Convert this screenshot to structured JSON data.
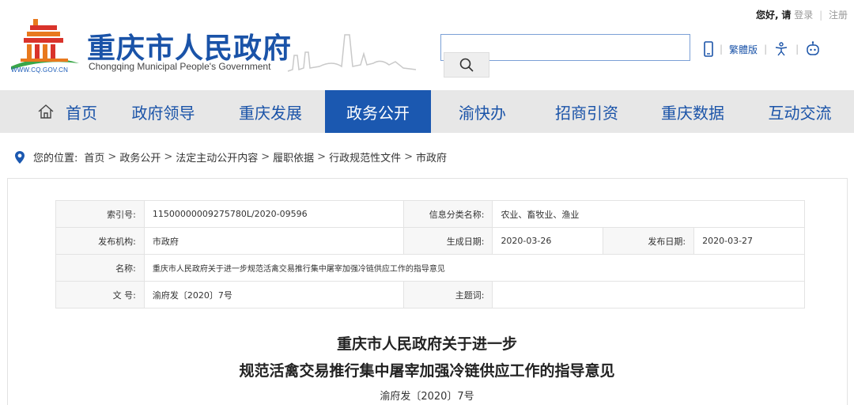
{
  "header": {
    "logo_url": "WWW.CQ.GOV.CN",
    "site_name_cn": "重庆市人民政府",
    "site_name_en": "Chongqing Municipal People's Government",
    "greeting": "您好,",
    "please": "请",
    "login": "登录",
    "register": "注册",
    "traditional": "繁體版"
  },
  "nav": {
    "items": [
      "首页",
      "政府领导",
      "重庆发展",
      "政务公开",
      "渝快办",
      "招商引资",
      "重庆数据",
      "互动交流"
    ],
    "active_index": 3
  },
  "breadcrumb": {
    "label": "您的位置:",
    "items": [
      "首页",
      "政务公开",
      "法定主动公开内容",
      "履职依据",
      "行政规范性文件",
      "市政府"
    ]
  },
  "meta": {
    "index_label": "索引号:",
    "index_value": "11500000009275780L/2020-09596",
    "category_label": "信息分类名称:",
    "category_value": "农业、畜牧业、渔业",
    "issuer_label": "发布机构:",
    "issuer_value": "市政府",
    "created_label": "生成日期:",
    "created_value": "2020-03-26",
    "published_label": "发布日期:",
    "published_value": "2020-03-27",
    "name_label": "名称:",
    "name_value": "重庆市人民政府关于进一步规范活禽交易推行集中屠宰加强冷链供应工作的指导意见",
    "docno_label": "文 号:",
    "docno_value": "渝府发〔2020〕7号",
    "subject_label": "主题词:",
    "subject_value": ""
  },
  "document": {
    "title_line1": "重庆市人民政府关于进一步",
    "title_line2": "规范活禽交易推行集中屠宰加强冷链供应工作的指导意见",
    "doc_number": "渝府发〔2020〕7号"
  },
  "colors": {
    "brand_blue": "#1b58b0",
    "nav_bg": "#e7e7e7",
    "logo_orange": "#e8791e",
    "logo_red": "#d9332b",
    "logo_green": "#3aa648"
  }
}
